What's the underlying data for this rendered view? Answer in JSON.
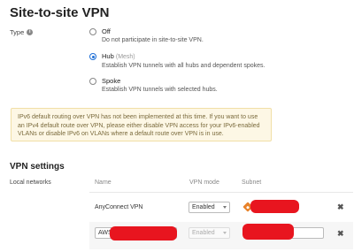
{
  "page": {
    "title": "Site-to-site VPN"
  },
  "type_field": {
    "label": "Type",
    "options": [
      {
        "title": "Off",
        "note": "",
        "desc": "Do not participate in site-to-site VPN.",
        "selected": false
      },
      {
        "title": "Hub",
        "note": "(Mesh)",
        "desc": "Establish VPN tunnels with all hubs and dependent spokes.",
        "selected": true
      },
      {
        "title": "Spoke",
        "note": "",
        "desc": "Establish VPN tunnels with selected hubs.",
        "selected": false
      }
    ]
  },
  "notice": {
    "text": "IPv6 default routing over VPN has not been implemented at this time. If you want to use an IPv4 default route over VPN, please either disable VPN access for your IPv6-enabled VLANs or disable IPv6 on VLANs where a default route over VPN is in use."
  },
  "vpn_settings": {
    "title": "VPN settings",
    "local_networks_label": "Local networks",
    "columns": {
      "name": "Name",
      "mode": "VPN mode",
      "subnet": "Subnet"
    },
    "rows": [
      {
        "name": "AnyConnect VPN",
        "mode": "Enabled",
        "subnet": ""
      },
      {
        "name": "AWS",
        "mode": "Enabled",
        "subnet": ""
      }
    ]
  },
  "colors": {
    "accent": "#1f6fd6",
    "redaction": "#e8151f",
    "notice_bg": "#fdf7e5"
  },
  "icons": {
    "info": "info-icon",
    "remove": "close-icon",
    "route": "route-icon"
  }
}
